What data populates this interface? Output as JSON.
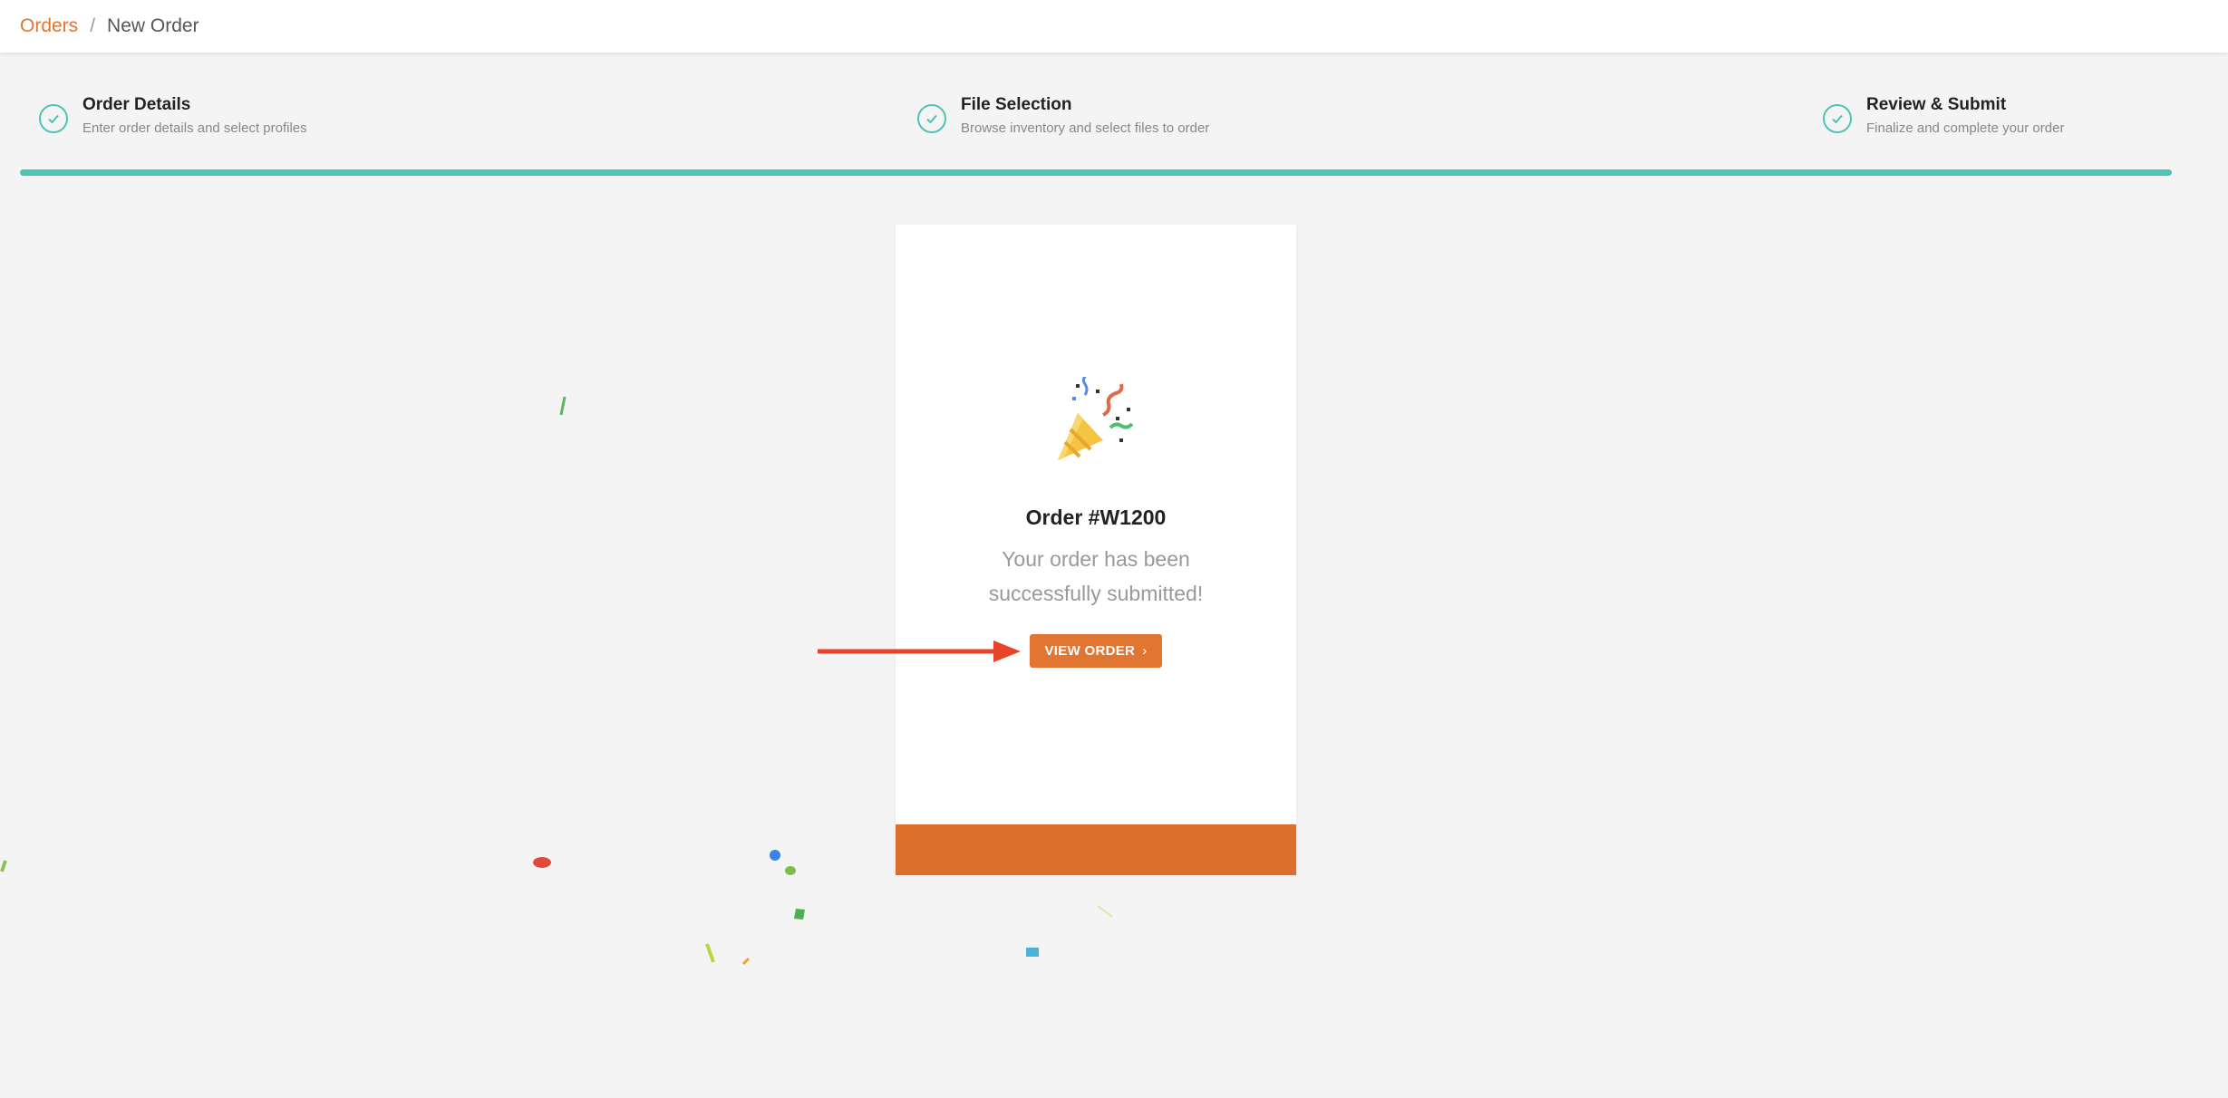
{
  "breadcrumb": {
    "parent": "Orders",
    "separator": "/",
    "current": "New Order"
  },
  "steps": [
    {
      "title": "Order Details",
      "subtitle": "Enter order details and select profiles",
      "status": "complete"
    },
    {
      "title": "File Selection",
      "subtitle": "Browse inventory and select files to order",
      "status": "complete"
    },
    {
      "title": "Review & Submit",
      "subtitle": "Finalize and complete your order",
      "status": "complete"
    }
  ],
  "progress": {
    "value": 1.0
  },
  "success_card": {
    "icon": "party-popper-icon",
    "title": "Order #W1200",
    "message": "Your order has been successfully submitted!",
    "button_label": "VIEW ORDER"
  },
  "colors": {
    "accent": "#e07632",
    "footer": "#dd6f2d",
    "teal": "#4ec3b6",
    "annotation_arrow": "#e8432b"
  }
}
